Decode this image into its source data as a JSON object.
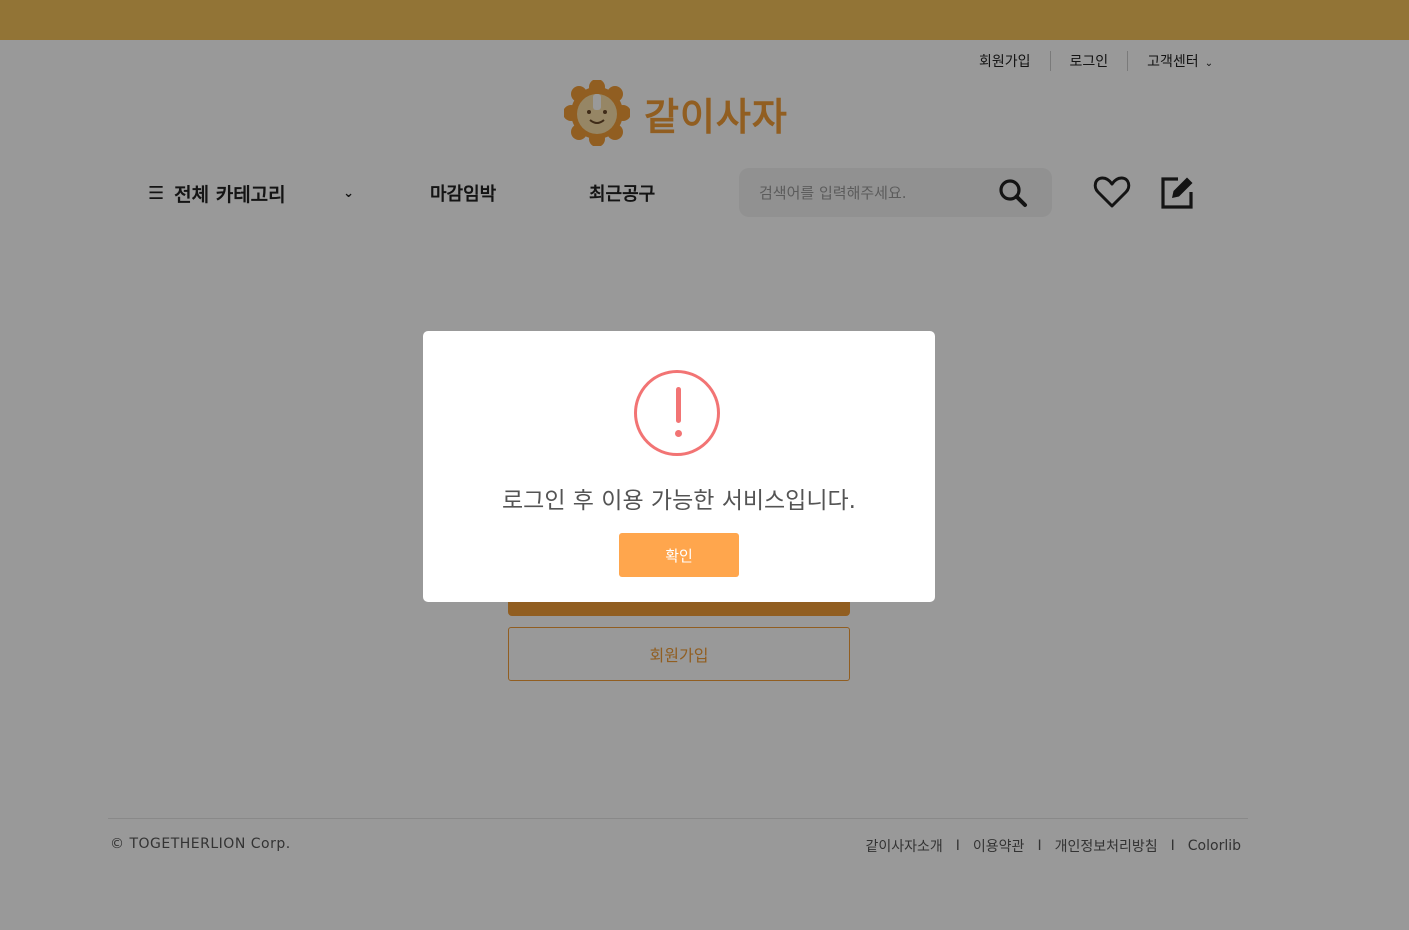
{
  "util_nav": {
    "signup": "회원가입",
    "login": "로그인",
    "support": "고객센터"
  },
  "logo": {
    "text": "같이사자"
  },
  "nav": {
    "all_category": "전체 카테고리",
    "links": [
      "마감임박",
      "최근공구"
    ],
    "search_placeholder": "검색어를 입력해주세요."
  },
  "icons": {
    "search": "search-icon",
    "wishlist": "heart-icon",
    "write": "edit-icon",
    "menu": "hamburger-icon",
    "warning": "exclamation-circle-icon"
  },
  "login_page": {
    "signup_button": "회원가입"
  },
  "footer": {
    "copyright": "© TOGETHERLION Corp.",
    "links": [
      "같이사자소개",
      "이용약관",
      "개인정보처리방침",
      "Colorlib"
    ],
    "separator": "I"
  },
  "modal": {
    "message": "로그인 후 이용 가능한 서비스입니다.",
    "confirm": "확인"
  },
  "colors": {
    "accent": "#f29d38",
    "topbar": "#f3c15a",
    "warning": "#f27474",
    "confirm_button": "#ffa64d"
  }
}
